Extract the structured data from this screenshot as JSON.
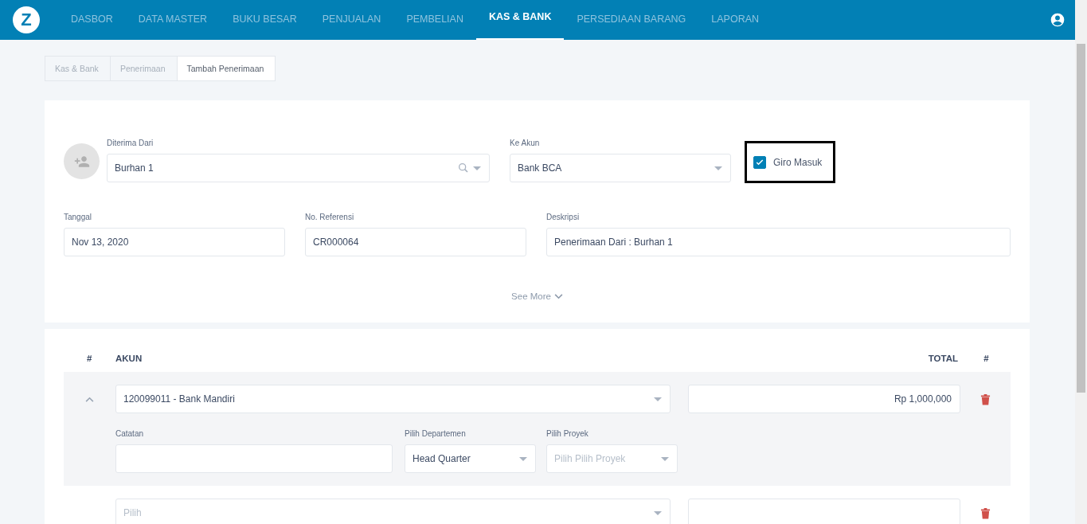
{
  "nav": {
    "items": [
      {
        "label": "DASBOR",
        "selected": false
      },
      {
        "label": "DATA MASTER",
        "selected": false
      },
      {
        "label": "BUKU BESAR",
        "selected": false
      },
      {
        "label": "PENJUALAN",
        "selected": false
      },
      {
        "label": "PEMBELIAN",
        "selected": false
      },
      {
        "label": "KAS & BANK",
        "selected": true
      },
      {
        "label": "PERSEDIAAN BARANG",
        "selected": false
      },
      {
        "label": "LAPORAN",
        "selected": false
      }
    ],
    "logo": "Z"
  },
  "breadcrumb": [
    {
      "label": "Kas & Bank",
      "selected": false
    },
    {
      "label": "Penerimaan",
      "selected": false
    },
    {
      "label": "Tambah Penerimaan",
      "selected": true
    }
  ],
  "form": {
    "received_from": {
      "label": "Diterima Dari",
      "value": "Burhan 1"
    },
    "to_account": {
      "label": "Ke Akun",
      "value": "Bank BCA"
    },
    "giro": {
      "label": "Giro Masuk",
      "checked": true
    },
    "date": {
      "label": "Tanggal",
      "value": "Nov 13, 2020"
    },
    "reference": {
      "label": "No. Referensi",
      "value": "CR000064"
    },
    "description": {
      "label": "Deskripsi",
      "value": "Penerimaan Dari : Burhan 1"
    },
    "see_more": "See More"
  },
  "table": {
    "columns": [
      "#",
      "AKUN",
      "TOTAL",
      "#"
    ],
    "rows": [
      {
        "expanded": true,
        "account": {
          "value": "120099011 - Bank Mandiri"
        },
        "total": "Rp 1,000,000",
        "note_label": "Catatan",
        "department": {
          "label": "Pilih Departemen",
          "value": "Head Quarter"
        },
        "project": {
          "label": "Pilih Proyek",
          "placeholder": "Pilih Pilih Proyek"
        }
      },
      {
        "expanded": false,
        "account": {
          "placeholder": "Pilih"
        }
      }
    ]
  }
}
